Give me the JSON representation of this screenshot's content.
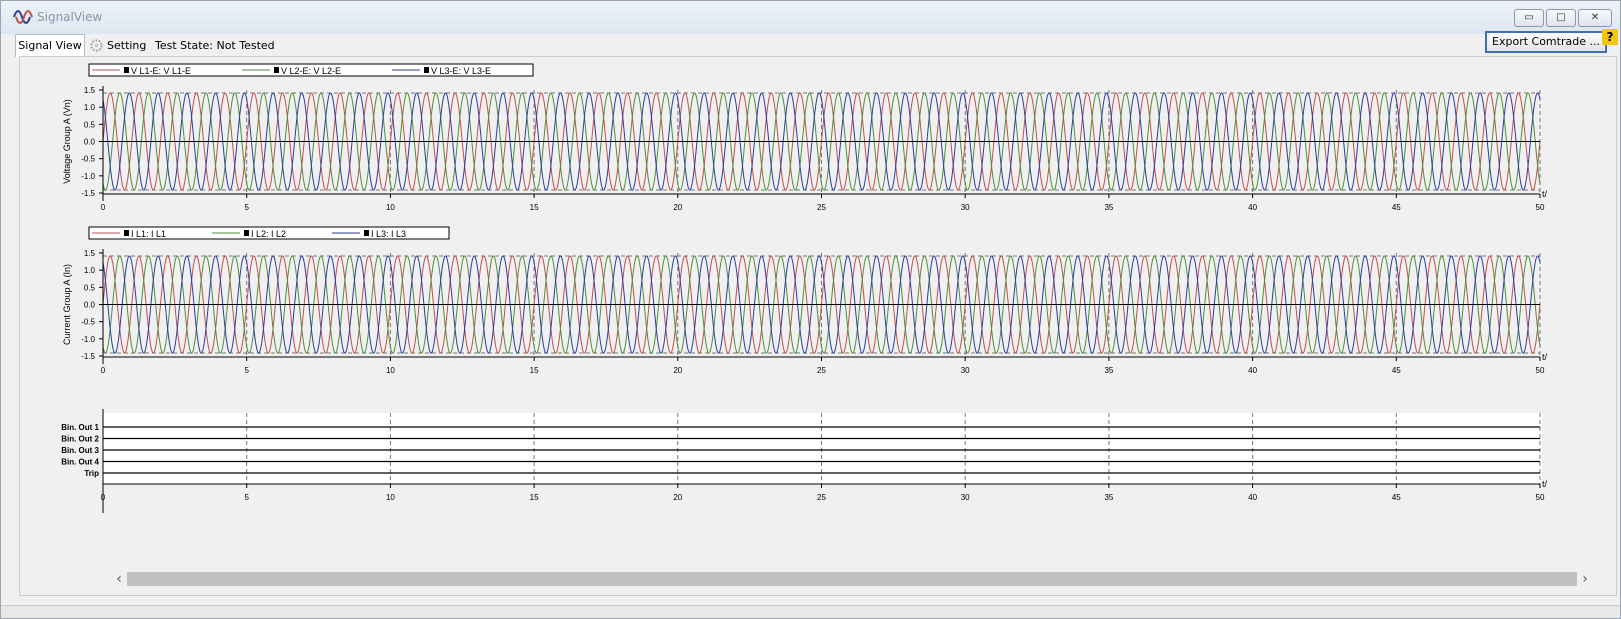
{
  "window": {
    "title": "SignalView",
    "minimize_label": "▭",
    "maximize_label": "□",
    "close_label": "✕"
  },
  "tabs": {
    "signal_view": "Signal View",
    "setting": "Setting",
    "test_state": "Test State: Not Tested"
  },
  "toolbar": {
    "export_label": "Export Comtrade ...",
    "help_label": "?"
  },
  "icons": {
    "app": "waveform-icon",
    "setting": "gear-icon"
  },
  "colors": {
    "l1": "#c0504d",
    "l2": "#4f8f3a",
    "l3": "#2c3d9e",
    "dashed": "#777777"
  },
  "chart_data": [
    {
      "type": "line",
      "ylabel": "Voltage Group A (Vn)",
      "xlabel": "t/",
      "xlim": [
        0,
        50
      ],
      "ylim": [
        -1.5,
        1.5
      ],
      "x_ticks": [
        0,
        5,
        10,
        15,
        20,
        25,
        30,
        35,
        40,
        45,
        50
      ],
      "y_ticks": [
        1.5,
        1.0,
        0.5,
        0.0,
        -0.5,
        -1.0,
        -1.5
      ],
      "y_tick_labels": [
        "1.5",
        "1.0",
        "0.5",
        "0.0",
        "-0.5",
        "-1.0",
        "-1.5"
      ],
      "reference_lines": [
        1.414,
        -1.414
      ],
      "grid": "dashed vertical",
      "legend_placement": "top-left",
      "series": [
        {
          "name": "V L1-E: V L1-E",
          "amplitude": 1.414,
          "phase_deg": 0,
          "cycles": 50
        },
        {
          "name": "V L2-E: V L2-E",
          "amplitude": 1.414,
          "phase_deg": -120,
          "cycles": 50
        },
        {
          "name": "V L3-E: V L3-E",
          "amplitude": 1.414,
          "phase_deg": 120,
          "cycles": 50
        }
      ]
    },
    {
      "type": "line",
      "ylabel": "Current Group A (In)",
      "xlabel": "t/",
      "xlim": [
        0,
        50
      ],
      "ylim": [
        -1.5,
        1.5
      ],
      "x_ticks": [
        0,
        5,
        10,
        15,
        20,
        25,
        30,
        35,
        40,
        45,
        50
      ],
      "y_ticks": [
        1.5,
        1.0,
        0.5,
        0.0,
        -0.5,
        -1.0,
        -1.5
      ],
      "y_tick_labels": [
        "1.5",
        "1.0",
        "0.5",
        "0.0",
        "-0.5",
        "-1.0",
        "-1.5"
      ],
      "reference_lines": [
        1.414,
        -1.414
      ],
      "grid": "dashed vertical",
      "legend_placement": "top-left",
      "series": [
        {
          "name": "I L1: I L1",
          "amplitude": 1.414,
          "phase_deg": 0,
          "cycles": 50
        },
        {
          "name": "I L2: I L2",
          "amplitude": 1.414,
          "phase_deg": -120,
          "cycles": 50
        },
        {
          "name": "I L3: I L3",
          "amplitude": 1.414,
          "phase_deg": 120,
          "cycles": 50
        }
      ]
    },
    {
      "type": "table",
      "xlabel": "t/",
      "xlim": [
        0,
        50
      ],
      "x_ticks": [
        0,
        5,
        10,
        15,
        20,
        25,
        30,
        35,
        40,
        45,
        50
      ],
      "channels": [
        "Bin. Out 1",
        "Bin. Out 2",
        "Bin. Out 3",
        "Bin. Out 4",
        "Trip"
      ],
      "states": [
        0,
        0,
        0,
        0,
        0
      ]
    }
  ]
}
